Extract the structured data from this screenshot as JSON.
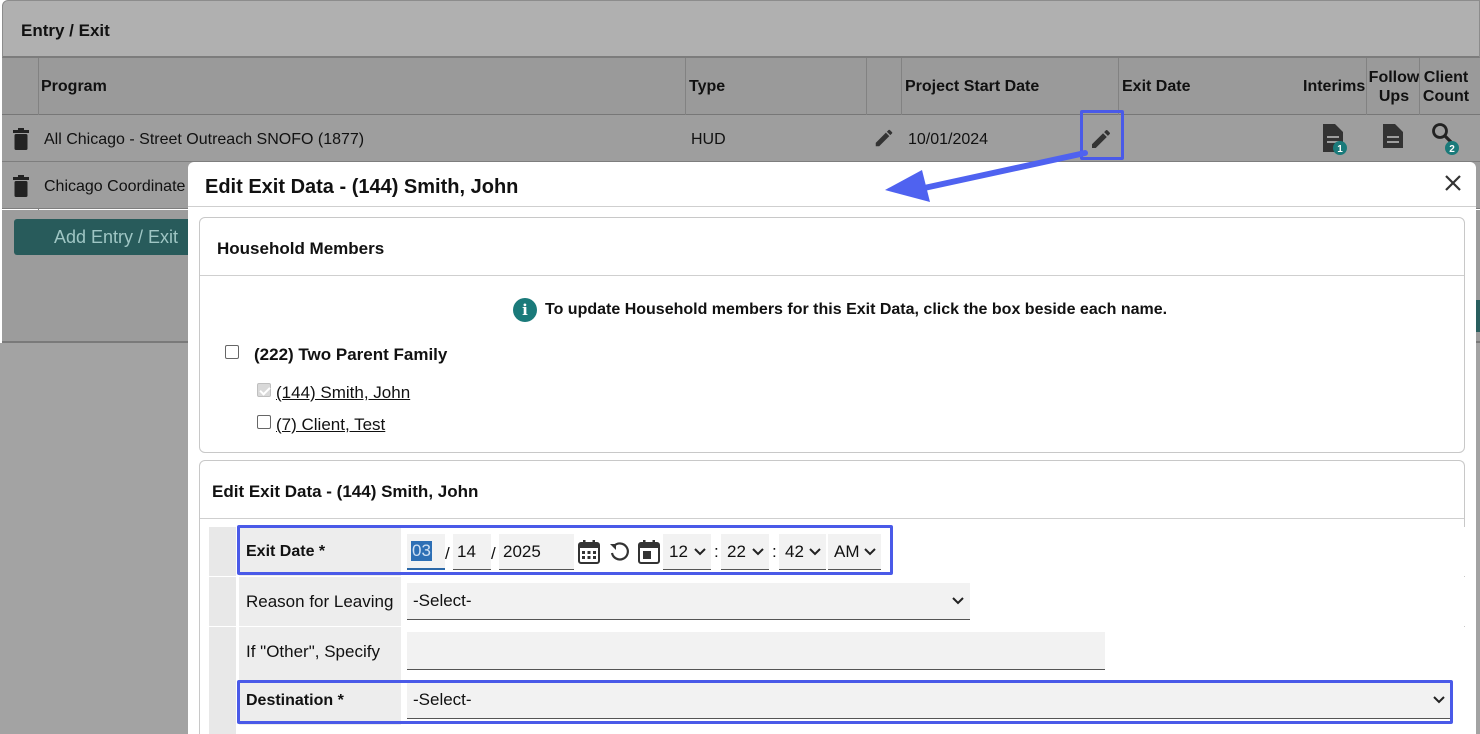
{
  "panel": {
    "title": "Entry / Exit",
    "columns": {
      "program": "Program",
      "type": "Type",
      "start": "Project Start Date",
      "exit": "Exit Date",
      "interims": "Interims",
      "follow_ups": "Follow Ups",
      "client_count": "Client Count"
    },
    "rows": [
      {
        "program": "All Chicago - Street Outreach SNOFO (1877)",
        "type": "HUD",
        "start_date": "10/01/2024",
        "exit_date": "",
        "interims_badge": "1",
        "client_count_badge": "2"
      },
      {
        "program": "Chicago Coordinate"
      }
    ],
    "add_button": "Add Entry / Exit"
  },
  "modal": {
    "title": "Edit Exit Data - (144) Smith, John",
    "household": {
      "title": "Household Members",
      "info": "To update Household members for this Exit Data, click the box beside each name.",
      "family": "(222) Two Parent Family",
      "members": [
        {
          "label": "(144) Smith, John",
          "checked": true,
          "disabled": true
        },
        {
          "label": "(7) Client, Test",
          "checked": false,
          "disabled": false
        }
      ]
    },
    "form": {
      "title": "Edit Exit Data - (144) Smith, John",
      "exit_date_label": "Exit Date *",
      "month": "03",
      "day": "14",
      "year": "2025",
      "hour": "12",
      "minute": "22",
      "second": "42",
      "ampm": "AM",
      "reason_label": "Reason for Leaving",
      "reason_value": "-Select-",
      "other_label": "If \"Other\", Specify",
      "other_value": "",
      "destination_label": "Destination *",
      "destination_value": "-Select-"
    }
  },
  "colors": {
    "teal": "#1a7a7a",
    "highlight": "#4a5ae8",
    "arrow": "#4f62f0"
  }
}
